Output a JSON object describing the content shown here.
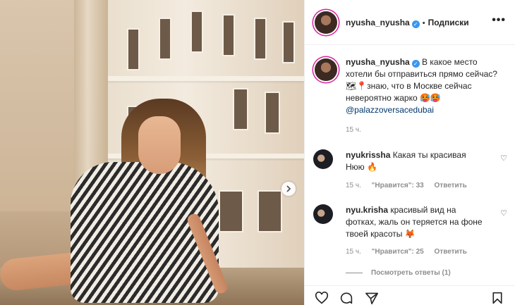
{
  "post": {
    "author": "nyusha_nyusha",
    "follow_label": "Подписки",
    "more_label": "•••",
    "caption": "В какое место хотели бы отправиться прямо сейчас?🗺📍знаю, что в Москве сейчас невероятно жарко 🥵🥵",
    "location_link": "@palazzoversacedubai",
    "time": "15 ч."
  },
  "comments": [
    {
      "author": "nyukrissha",
      "text": "Какая ты красивая Нюю 🔥",
      "time": "15 ч.",
      "likes": "\"Нравится\": 33",
      "reply_label": "Ответить"
    },
    {
      "author": "nyu.krisha",
      "text": "красивый вид на фотках, жаль он теряется на фоне твоей красоты 🦊",
      "time": "15 ч.",
      "likes": "\"Нравится\": 25",
      "reply_label": "Ответить"
    }
  ],
  "replies_label": "Посмотреть ответы (1)",
  "icons": {
    "verified": "verified-badge-icon",
    "next": "chevron-right-icon",
    "like": "heart-icon",
    "comment": "comment-bubble-icon",
    "share": "paper-plane-icon",
    "save": "bookmark-icon"
  },
  "colors": {
    "accent": "#3897f0",
    "link": "#00376b",
    "muted": "#8e8e8e",
    "text": "#262626"
  }
}
